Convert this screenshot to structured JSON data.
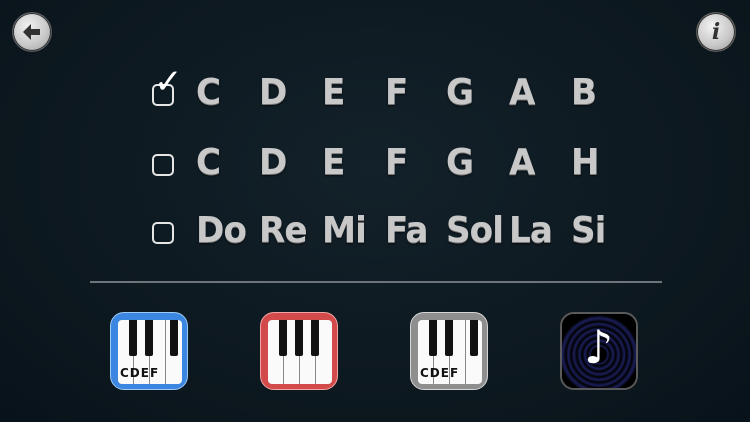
{
  "header": {
    "back_icon": "arrow-left-icon",
    "info_icon": "info-icon",
    "info_label": "i"
  },
  "notation_rows": [
    {
      "selected": true,
      "notes": [
        "C",
        "D",
        "E",
        "F",
        "G",
        "A",
        "B"
      ]
    },
    {
      "selected": false,
      "notes": [
        "C",
        "D",
        "E",
        "F",
        "G",
        "A",
        "H"
      ]
    },
    {
      "selected": false,
      "notes": [
        "Do",
        "Re",
        "Mi",
        "Fa",
        "Sol",
        "La",
        "Si"
      ]
    }
  ],
  "apps": [
    {
      "name": "piano-blue",
      "color": "#3b86e0",
      "keys_label": "CDEF"
    },
    {
      "name": "piano-red",
      "color": "#d24a4a",
      "keys_label": ""
    },
    {
      "name": "piano-gray",
      "color": "#8e8e8e",
      "keys_label": "CDEF"
    },
    {
      "name": "music",
      "color": "#1b1f5a",
      "icon": "music-note-icon"
    }
  ]
}
